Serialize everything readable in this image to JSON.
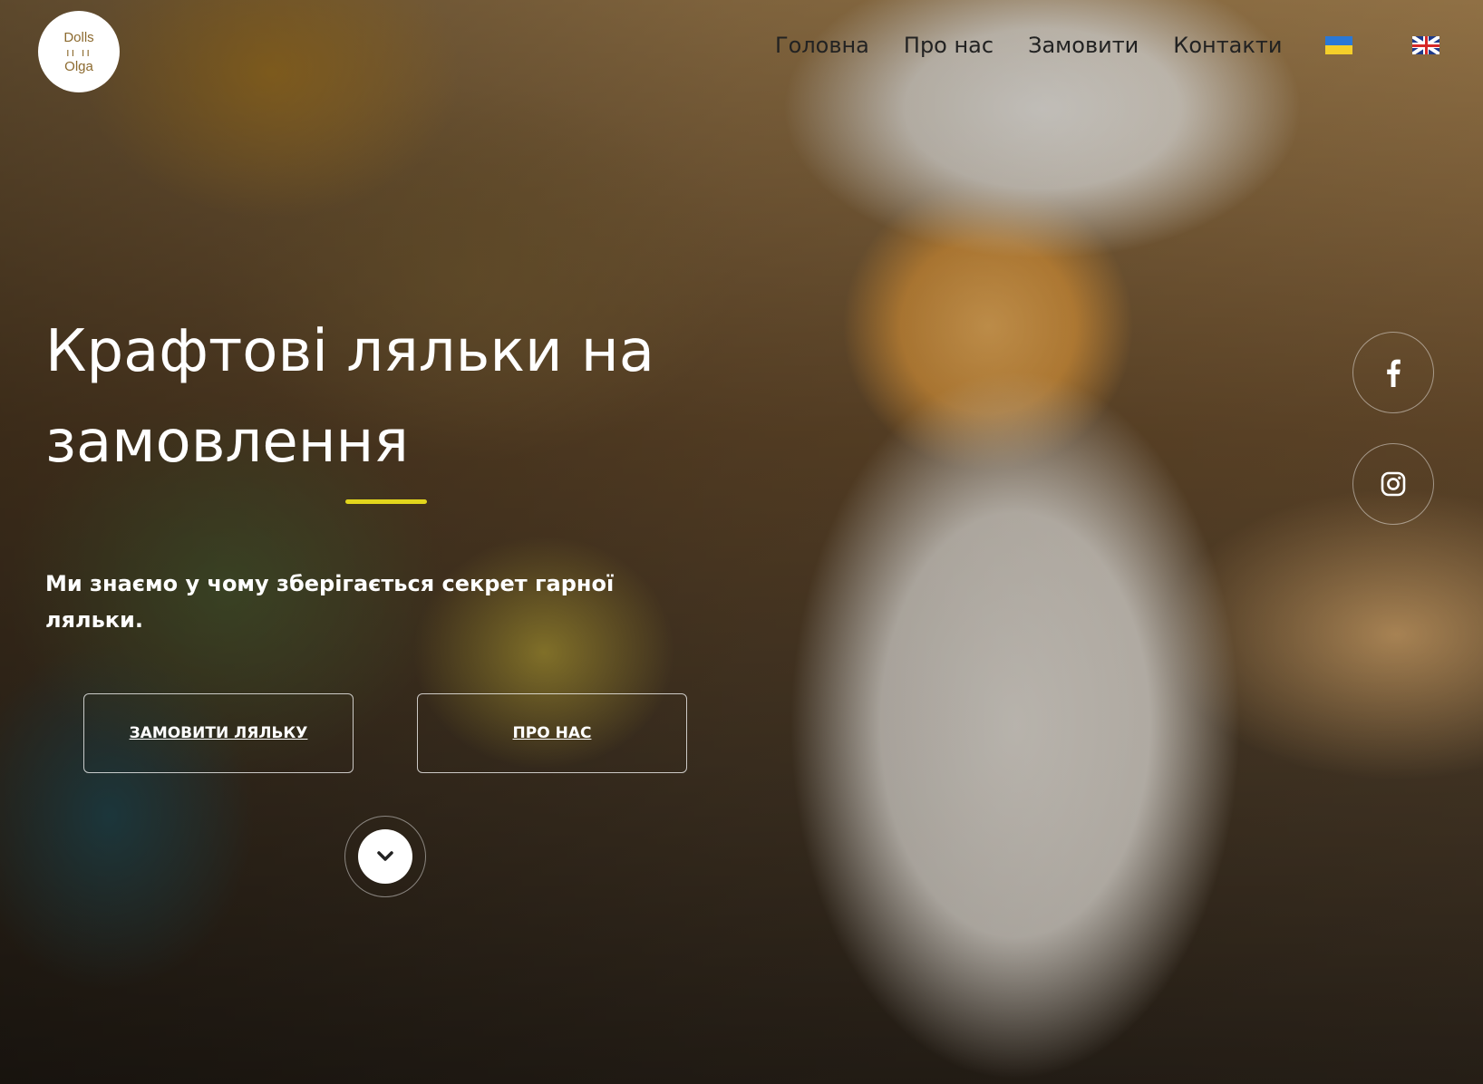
{
  "header": {
    "logo": {
      "line1": "Dolls",
      "line2": "Olga",
      "mid": "ıı ıı"
    },
    "nav": [
      {
        "label": "Головна"
      },
      {
        "label": "Про нас"
      },
      {
        "label": "Замовити"
      },
      {
        "label": "Контакти"
      }
    ],
    "languages": [
      "ukrainian-flag-icon",
      "uk-flag-icon"
    ]
  },
  "hero": {
    "title": "Крафтові ляльки на замовлення",
    "subtitle": "Ми знаємо у чому зберігається секрет гарної ляльки.",
    "accent_color": "#e2d51c",
    "buttons": {
      "order": "ЗАМОВИТИ ЛЯЛЬКУ",
      "about": "ПРО НАС"
    },
    "scroll_icon": "chevron-down-icon"
  },
  "social": [
    {
      "icon": "facebook-icon"
    },
    {
      "icon": "instagram-icon"
    }
  ]
}
